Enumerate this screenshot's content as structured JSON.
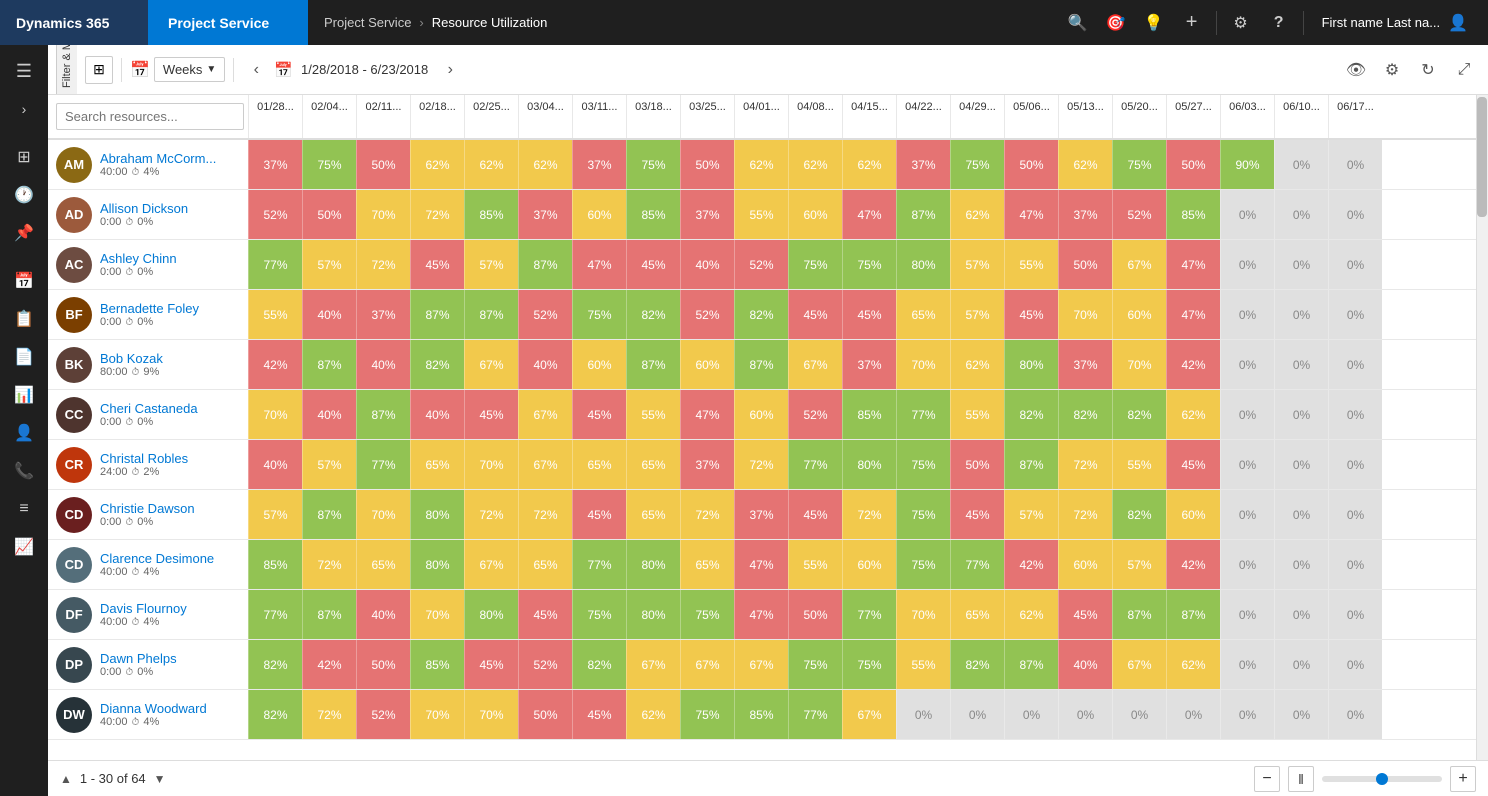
{
  "topNav": {
    "dynamics": "Dynamics 365",
    "projectService": "Project Service",
    "breadcrumb": [
      "Project Service",
      "Resource Utilization"
    ],
    "breadcrumbSeparator": ">",
    "user": "First name Last na...",
    "icons": [
      "search",
      "target",
      "bulb",
      "plus",
      "gear",
      "question"
    ]
  },
  "toolbar": {
    "calendarIcon": "📅",
    "weeksLabel": "Weeks",
    "prevArrow": "‹",
    "nextArrow": "›",
    "dateRange": "1/28/2018 - 6/23/2018",
    "viewIcon": "👁",
    "settingsIcon": "⚙",
    "refreshIcon": "↻",
    "expandIcon": "⤢"
  },
  "filter": {
    "label": "Filter & Map View",
    "arrow": "›"
  },
  "search": {
    "placeholder": "Search resources..."
  },
  "columns": [
    "01/28...",
    "02/04...",
    "02/11...",
    "02/18...",
    "02/25...",
    "03/04...",
    "03/11...",
    "03/18...",
    "03/25...",
    "04/01...",
    "04/08...",
    "04/15...",
    "04/22...",
    "04/29...",
    "05/06...",
    "05/13...",
    "05/20...",
    "05/27...",
    "06/03...",
    "06/10...",
    "06/17..."
  ],
  "resources": [
    {
      "name": "Abraham McCorm...",
      "hours": "40:00",
      "clockIcon": "⏱",
      "percent": "4%",
      "avatarColor": "#8B6914",
      "initials": "AM",
      "cells": [
        37,
        75,
        50,
        62,
        62,
        62,
        37,
        75,
        50,
        62,
        62,
        62,
        37,
        75,
        50,
        62,
        75,
        50,
        90,
        0,
        0
      ]
    },
    {
      "name": "Allison Dickson",
      "hours": "0:00",
      "clockIcon": "⏱",
      "percent": "0%",
      "avatarColor": "#5C3317",
      "initials": "AD",
      "cells": [
        52,
        50,
        70,
        72,
        85,
        37,
        60,
        85,
        37,
        55,
        60,
        47,
        87,
        62,
        47,
        37,
        52,
        85,
        0,
        0,
        0
      ]
    },
    {
      "name": "Ashley Chinn",
      "hours": "0:00",
      "clockIcon": "⏱",
      "percent": "0%",
      "avatarColor": "#6D4C41",
      "initials": "AC",
      "cells": [
        77,
        57,
        72,
        45,
        57,
        87,
        47,
        45,
        40,
        52,
        75,
        75,
        80,
        57,
        55,
        50,
        67,
        47,
        0,
        0,
        0
      ]
    },
    {
      "name": "Bernadette Foley",
      "hours": "0:00",
      "clockIcon": "⏱",
      "percent": "0%",
      "avatarColor": "#7B3F00",
      "initials": "BF",
      "cells": [
        55,
        40,
        37,
        87,
        87,
        52,
        75,
        82,
        52,
        82,
        45,
        45,
        65,
        57,
        45,
        70,
        60,
        47,
        0,
        0,
        0
      ]
    },
    {
      "name": "Bob Kozak",
      "hours": "80:00",
      "clockIcon": "⏱",
      "percent": "9%",
      "avatarColor": "#5D4037",
      "initials": "BK",
      "cells": [
        42,
        87,
        40,
        82,
        67,
        40,
        60,
        87,
        60,
        87,
        67,
        37,
        70,
        62,
        80,
        37,
        70,
        42,
        0,
        0,
        0
      ]
    },
    {
      "name": "Cheri Castaneda",
      "hours": "0:00",
      "clockIcon": "⏱",
      "percent": "0%",
      "avatarColor": "#4E342E",
      "initials": "CC",
      "cells": [
        70,
        40,
        87,
        40,
        45,
        67,
        45,
        55,
        47,
        60,
        52,
        85,
        77,
        55,
        82,
        82,
        82,
        62,
        0,
        0,
        0
      ]
    },
    {
      "name": "Christal Robles",
      "hours": "24:00",
      "clockIcon": "⏱",
      "percent": "2%",
      "avatarColor": "#BF360C",
      "initials": "CR",
      "cells": [
        40,
        57,
        77,
        65,
        70,
        67,
        65,
        65,
        37,
        72,
        77,
        80,
        75,
        50,
        87,
        72,
        55,
        45,
        0,
        0,
        0
      ]
    },
    {
      "name": "Christie Dawson",
      "hours": "0:00",
      "clockIcon": "⏱",
      "percent": "0%",
      "avatarColor": "#6A1F1F",
      "initials": "CD",
      "cells": [
        57,
        87,
        70,
        80,
        72,
        72,
        45,
        65,
        72,
        37,
        45,
        72,
        75,
        45,
        57,
        72,
        82,
        60,
        0,
        0,
        0
      ]
    },
    {
      "name": "Clarence Desimone",
      "hours": "40:00",
      "clockIcon": "⏱",
      "percent": "4%",
      "avatarColor": "#546E7A",
      "initials": "CD",
      "cells": [
        85,
        72,
        65,
        80,
        67,
        65,
        77,
        80,
        65,
        47,
        55,
        60,
        75,
        77,
        42,
        60,
        57,
        42,
        0,
        0,
        0
      ]
    },
    {
      "name": "Davis Flournoy",
      "hours": "40:00",
      "clockIcon": "⏱",
      "percent": "4%",
      "avatarColor": "#455A64",
      "initials": "DF",
      "cells": [
        77,
        87,
        40,
        70,
        80,
        45,
        75,
        80,
        75,
        47,
        50,
        77,
        70,
        65,
        62,
        45,
        87,
        87,
        0,
        0,
        0
      ]
    },
    {
      "name": "Dawn Phelps",
      "hours": "0:00",
      "clockIcon": "⏱",
      "percent": "0%",
      "avatarColor": "#37474F",
      "initials": "DP",
      "cells": [
        82,
        42,
        50,
        85,
        45,
        52,
        82,
        67,
        67,
        67,
        75,
        75,
        55,
        82,
        87,
        40,
        67,
        62,
        0,
        0,
        0
      ]
    },
    {
      "name": "Dianna Woodward",
      "hours": "40:00",
      "clockIcon": "⏱",
      "percent": "4%",
      "avatarColor": "#263238",
      "initials": "DW",
      "cells": [
        82,
        72,
        52,
        70,
        70,
        50,
        45,
        62,
        75,
        85,
        77,
        67,
        0,
        0,
        0,
        0,
        0,
        0,
        0,
        0,
        0
      ]
    }
  ],
  "pagination": {
    "info": "1 - 30 of 64",
    "prevArrow": "▲",
    "nextArrow": "▼",
    "minusBtn": "−",
    "pauseBtn": "‖",
    "plusBtn": "+"
  },
  "colors": {
    "green": "#92c353",
    "yellow": "#f2c94c",
    "red": "#e57373",
    "pink": "#f48fb1",
    "gray": "#e0e0e0",
    "accent": "#0078d4"
  }
}
